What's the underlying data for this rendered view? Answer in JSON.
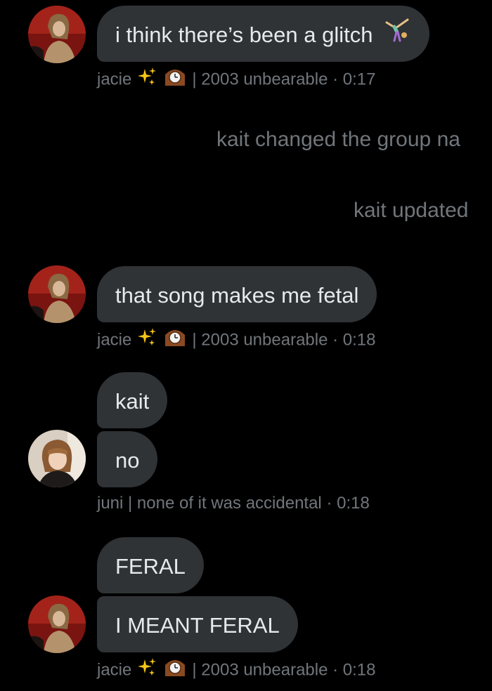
{
  "conversation": {
    "message_1": {
      "text": "i think there’s been a glitch",
      "emoji": "cartwheel-emoji",
      "sender": "jacie",
      "status_emojis": [
        "sparkles-emoji",
        "mantelpiece-clock-emoji"
      ],
      "bio": "| 2003 unbearable",
      "time": "· 0:17"
    },
    "system_1": "kait changed the group na",
    "system_2": "kait updated",
    "message_2": {
      "text": "that song makes me fetal",
      "sender": "jacie",
      "status_emojis": [
        "sparkles-emoji",
        "mantelpiece-clock-emoji"
      ],
      "bio": "| 2003 unbearable",
      "time": "· 0:18"
    },
    "message_3": {
      "lines": [
        "kait",
        "no"
      ],
      "sender_meta": "juni | none of it was accidental",
      "time": "· 0:18"
    },
    "message_4": {
      "lines": [
        "FERAL",
        "I MEANT FERAL"
      ],
      "sender": "jacie",
      "status_emojis": [
        "sparkles-emoji",
        "mantelpiece-clock-emoji"
      ],
      "bio": "| 2003 unbearable",
      "time": "· 0:18"
    }
  },
  "colors": {
    "background": "#000000",
    "bubble": "#2f3336",
    "text": "#e7e9ea",
    "meta": "#71767b"
  }
}
